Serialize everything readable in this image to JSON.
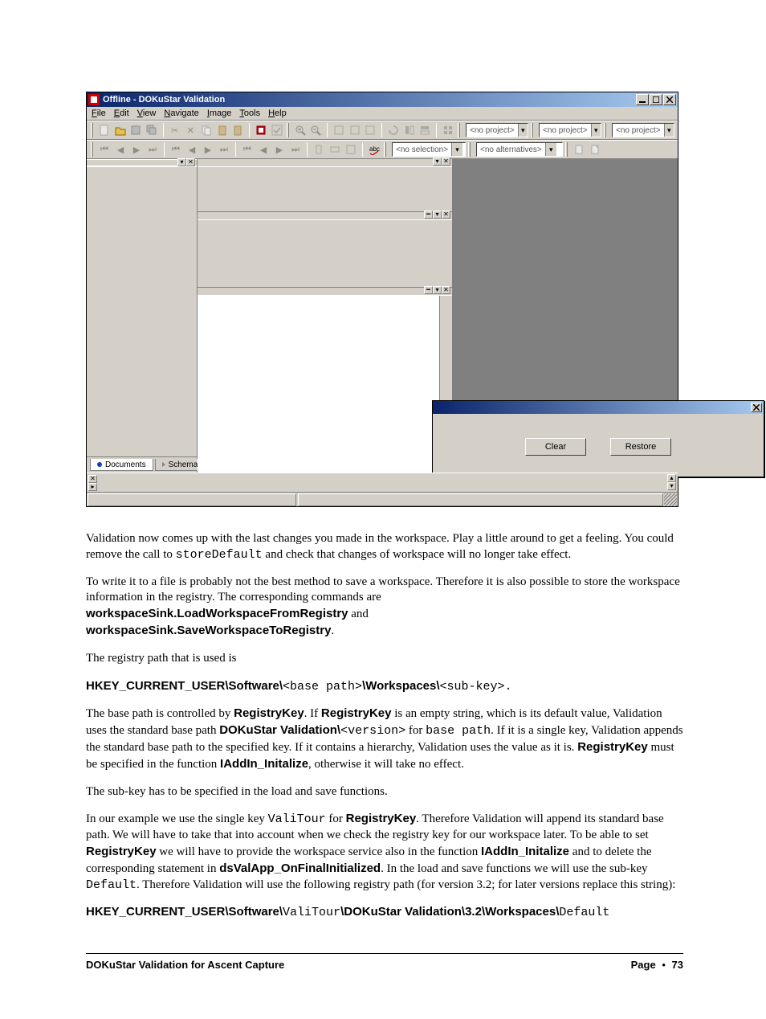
{
  "window": {
    "title": "Offline - DOKuStar Validation",
    "controls": {
      "min": "_",
      "max": "☐",
      "close": "✕"
    }
  },
  "menu": {
    "file": "File",
    "edit": "Edit",
    "view": "View",
    "navigate": "Navigate",
    "image": "Image",
    "tools": "Tools",
    "help": "Help"
  },
  "combos": {
    "proj1": "<no project>",
    "proj2": "<no project>",
    "proj3": "<no project>",
    "sel": "<no selection>",
    "alt": "<no alternatives>"
  },
  "tabs": {
    "documents": "Documents",
    "schema": "Schema"
  },
  "dialog": {
    "clear": "Clear",
    "restore": "Restore"
  },
  "doc": {
    "p1a": "Validation now comes up with the last changes you made in the workspace. Play a little around to get a feeling. You could remove the call to ",
    "p1code": "storeDefault",
    "p1b": " and check that changes of workspace will no longer take effect.",
    "p2": "To write it to a file is probably not the best method to save a workspace. Therefore it is also possible to store the workspace information in the registry. The corresponding commands are",
    "cmd1": "workspaceSink.LoadWorkspaceFromRegistry",
    "and": " and",
    "cmd2": "workspaceSink.SaveWorkspaceToRegistry",
    "p3": "The registry path that is used is",
    "reg1a": "HKEY_CURRENT_USER\\Software\\",
    "reg1b": "<base path>",
    "reg1c": "\\Workspaces\\",
    "reg1d": "<sub-key>",
    "reg1e": ".",
    "p4a": "The base path is controlled by ",
    "p4b": "RegistryKey",
    "p4c": ". If ",
    "p4d": "RegistryKey",
    "p4e": " is an empty string, which is its default value, Validation uses the standard base path ",
    "p4f": "DOKuStar Validation\\",
    "p4g": "<version>",
    "p4h": " for ",
    "p4i": "base path",
    "p4j": ". If it is a single key, Validation appends the standard base path to the specified key. If it contains a hierarchy, Validation uses the value as it is. ",
    "p4k": "RegistryKey",
    "p4l": " must be specified in the function ",
    "p4m": "IAddIn_Initalize",
    "p4n": ", otherwise it will take no effect.",
    "p5": "The sub-key has to be specified in the load and save functions.",
    "p6a": "In our example we use the single key ",
    "p6b": "ValiTour",
    "p6c": " for ",
    "p6d": "RegistryKey",
    "p6e": ". Therefore Validation will append its standard base path. We will have to take that into account when we check the registry key for our workspace later. To be able to set ",
    "p6f": "RegistryKey",
    "p6g": " we will have to provide the workspace service also in the function ",
    "p6h": "IAddIn_Initalize",
    "p6i": " and to delete the corresponding statement in ",
    "p6j": "dsValApp_OnFinalInitialized",
    "p6k": ". In the load and save functions we will use the sub-key ",
    "p6l": "Default",
    "p6m": ". Therefore Validation will use the following registry path (for version 3.2; for later versions replace this string):",
    "reg2a": "HKEY_CURRENT_USER\\Software\\",
    "reg2b": "ValiTour",
    "reg2c": "\\DOKuStar Validation\\3.2\\Workspaces\\",
    "reg2d": "Default"
  },
  "footer": {
    "left": "DOKuStar Validation for Ascent Capture",
    "page_label": "Page",
    "bullet": "•",
    "page_num": "73"
  }
}
